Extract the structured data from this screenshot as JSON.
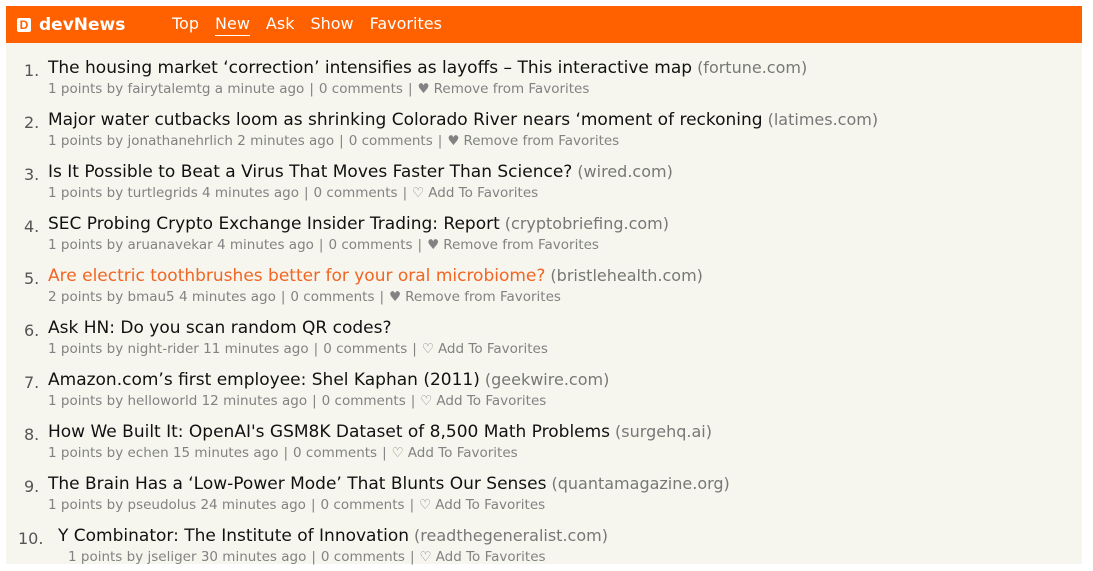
{
  "brand": {
    "logo_letter": "D",
    "name": "devNews"
  },
  "nav": [
    {
      "label": "Top",
      "active": false
    },
    {
      "label": "New",
      "active": true
    },
    {
      "label": "Ask",
      "active": false
    },
    {
      "label": "Show",
      "active": false
    },
    {
      "label": "Favorites",
      "active": false
    }
  ],
  "colors": {
    "topbar": "#ff6000",
    "background": "#f6f6ef",
    "visited_title": "#f26522",
    "meta_text": "#828282"
  },
  "stories": [
    {
      "rank": "1.",
      "title": "The housing market ‘correction’ intensifies as layoffs – This interactive map",
      "domain": "(fortune.com)",
      "points": "1 points",
      "user": "fairytalemtg",
      "time": "a minute ago",
      "comments": "0 comments",
      "favorite_icon": "heart-filled-icon",
      "favorite_glyph": "♥",
      "favorite_label": "Remove from Favorites",
      "visited": false
    },
    {
      "rank": "2.",
      "title": "Major water cutbacks loom as shrinking Colorado River nears ‘moment of reckoning",
      "domain": "(latimes.com)",
      "points": "1 points",
      "user": "jonathanehrlich",
      "time": "2 minutes ago",
      "comments": "0 comments",
      "favorite_icon": "heart-filled-icon",
      "favorite_glyph": "♥",
      "favorite_label": "Remove from Favorites",
      "visited": false
    },
    {
      "rank": "3.",
      "title": "Is It Possible to Beat a Virus That Moves Faster Than Science?",
      "domain": "(wired.com)",
      "points": "1 points",
      "user": "turtlegrids",
      "time": "4 minutes ago",
      "comments": "0 comments",
      "favorite_icon": "heart-outline-icon",
      "favorite_glyph": "♡",
      "favorite_label": "Add To Favorites",
      "visited": false
    },
    {
      "rank": "4.",
      "title": "SEC Probing Crypto Exchange Insider Trading: Report",
      "domain": "(cryptobriefing.com)",
      "points": "1 points",
      "user": "aruanavekar",
      "time": "4 minutes ago",
      "comments": "0 comments",
      "favorite_icon": "heart-filled-icon",
      "favorite_glyph": "♥",
      "favorite_label": "Remove from Favorites",
      "visited": false
    },
    {
      "rank": "5.",
      "title": "Are electric toothbrushes better for your oral microbiome?",
      "domain": "(bristlehealth.com)",
      "points": "2 points",
      "user": "bmau5",
      "time": "4 minutes ago",
      "comments": "0 comments",
      "favorite_icon": "heart-filled-icon",
      "favorite_glyph": "♥",
      "favorite_label": "Remove from Favorites",
      "visited": true
    },
    {
      "rank": "6.",
      "title": "Ask HN: Do you scan random QR codes?",
      "domain": "",
      "points": "1 points",
      "user": "night-rider",
      "time": "11 minutes ago",
      "comments": "0 comments",
      "favorite_icon": "heart-outline-icon",
      "favorite_glyph": "♡",
      "favorite_label": "Add To Favorites",
      "visited": false
    },
    {
      "rank": "7.",
      "title": "Amazon.com’s first employee: Shel Kaphan (2011)",
      "domain": "(geekwire.com)",
      "points": "1 points",
      "user": "helloworld",
      "time": "12 minutes ago",
      "comments": "0 comments",
      "favorite_icon": "heart-outline-icon",
      "favorite_glyph": "♡",
      "favorite_label": "Add To Favorites",
      "visited": false
    },
    {
      "rank": "8.",
      "title": "How We Built It: OpenAI's GSM8K Dataset of 8,500 Math Problems",
      "domain": "(surgehq.ai)",
      "points": "1 points",
      "user": "echen",
      "time": "15 minutes ago",
      "comments": "0 comments",
      "favorite_icon": "heart-outline-icon",
      "favorite_glyph": "♡",
      "favorite_label": "Add To Favorites",
      "visited": false
    },
    {
      "rank": "9.",
      "title": "The Brain Has a ‘Low-Power Mode’ That Blunts Our Senses",
      "domain": "(quantamagazine.org)",
      "points": "1 points",
      "user": "pseudolus",
      "time": "24 minutes ago",
      "comments": "0 comments",
      "favorite_icon": "heart-outline-icon",
      "favorite_glyph": "♡",
      "favorite_label": "Add To Favorites",
      "visited": false
    },
    {
      "rank": "10.",
      "title": "Y Combinator: The Institute of Innovation",
      "domain": "(readthegeneralist.com)",
      "points": "1 points",
      "user": "jseliger",
      "time": "30 minutes ago",
      "comments": "0 comments",
      "favorite_icon": "heart-outline-icon",
      "favorite_glyph": "♡",
      "favorite_label": "Add To Favorites",
      "visited": false
    }
  ]
}
